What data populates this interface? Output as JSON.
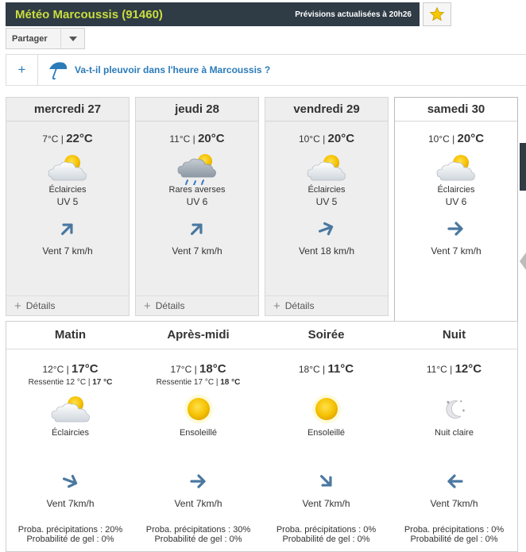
{
  "header": {
    "title": "Météo Marcoussis (91460)",
    "updated": "Prévisions actualisées à 20h26",
    "favorite_icon": "star-icon"
  },
  "share": {
    "label": "Partager"
  },
  "rain": {
    "question": "Va-t-il pleuvoir dans l'heure à Marcoussis ?",
    "plus": "+"
  },
  "days": [
    {
      "name": "mercredi 27",
      "min": "7°C",
      "max": "22°C",
      "icon": "partly-cloudy-icon",
      "desc": "Éclaircies",
      "uv": "UV 5",
      "wind": "Vent 7 km/h",
      "details": "Détails"
    },
    {
      "name": "jeudi 28",
      "min": "11°C",
      "max": "20°C",
      "icon": "showers-icon",
      "desc": "Rares averses",
      "uv": "UV 6",
      "wind": "Vent 7 km/h",
      "details": "Détails"
    },
    {
      "name": "vendredi 29",
      "min": "10°C",
      "max": "20°C",
      "icon": "partly-cloudy-icon",
      "desc": "Éclaircies",
      "uv": "UV 5",
      "wind": "Vent 18 km/h",
      "details": "Détails"
    },
    {
      "name": "samedi 30",
      "min": "10°C",
      "max": "20°C",
      "icon": "partly-cloudy-icon",
      "desc": "Éclaircies",
      "uv": "UV 6",
      "wind": "Vent 7 km/h"
    }
  ],
  "periods": [
    {
      "name": "Matin",
      "min": "12°C",
      "max": "17°C",
      "feel_label": "Ressentie 12 °C",
      "feel_max": "17 °C",
      "icon": "partly-cloudy-icon",
      "desc": "Éclaircies",
      "wind": "Vent 7km/h",
      "proba": "Proba. précipitations : 20%",
      "gel": "Probabilité de gel : 0%"
    },
    {
      "name": "Après-midi",
      "min": "17°C",
      "max": "18°C",
      "feel_label": "Ressentie 17 °C",
      "feel_max": "18 °C",
      "icon": "sun-icon",
      "desc": "Ensoleillé",
      "wind": "Vent 7km/h",
      "proba": "Proba. précipitations : 30%",
      "gel": "Probabilité de gel : 0%"
    },
    {
      "name": "Soirée",
      "min": "18°C",
      "max": "11°C",
      "icon": "sun-icon",
      "desc": "Ensoleillé",
      "wind": "Vent 7km/h",
      "proba": "Proba. précipitations : 0%",
      "gel": "Probabilité de gel : 0%"
    },
    {
      "name": "Nuit",
      "min": "11°C",
      "max": "12°C",
      "icon": "moon-icon",
      "desc": "Nuit claire",
      "wind": "Vent 7km/h",
      "proba": "Proba. précipitations : 0%",
      "gel": "Probabilité de gel : 0%"
    }
  ],
  "colors": {
    "header_bg": "#2f3b45",
    "title": "#c8dd3f",
    "link": "#2b7bb9",
    "arrow": "#4a78a0",
    "sun": "#f2c200",
    "star": "#f5c800"
  }
}
